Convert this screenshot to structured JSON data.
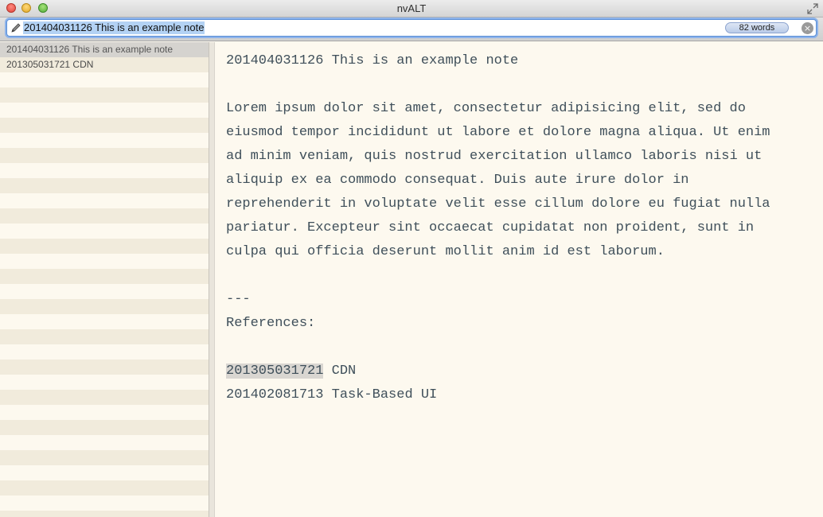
{
  "window": {
    "title": "nvALT"
  },
  "toolbar": {
    "search_value": "201404031126 This is an example note",
    "word_count": "82 words",
    "clear_glyph": "×"
  },
  "note_list": {
    "items": [
      {
        "label": "201404031126 This is an example note",
        "selected": true
      },
      {
        "label": "201305031721 CDN",
        "selected": false
      }
    ]
  },
  "editor": {
    "title_line": "201404031126 This is an example note",
    "body_lines": [
      "Lorem ipsum dolor sit amet, consectetur adipisicing elit, sed do",
      "eiusmod tempor incididunt ut labore et dolore magna aliqua. Ut enim",
      "ad minim veniam, quis nostrud exercitation ullamco laboris nisi ut",
      "aliquip ex ea commodo consequat. Duis aute irure dolor in",
      "reprehenderit in voluptate velit esse cillum dolore eu fugiat nulla",
      "pariatur. Excepteur sint occaecat cupidatat non proident, sunt in",
      "culpa qui officia deserunt mollit anim id est laborum."
    ],
    "separator": "---",
    "references_label": "References:",
    "references": [
      {
        "id": "201305031721",
        "title": " CDN"
      },
      {
        "id": "201402081713",
        "title": " Task-Based UI"
      }
    ]
  },
  "colors": {
    "background": "#fdf9ef",
    "row_stripe": "#f1ebdc",
    "editor_text": "#3f4f5a",
    "selection": "#b3d2f4"
  }
}
